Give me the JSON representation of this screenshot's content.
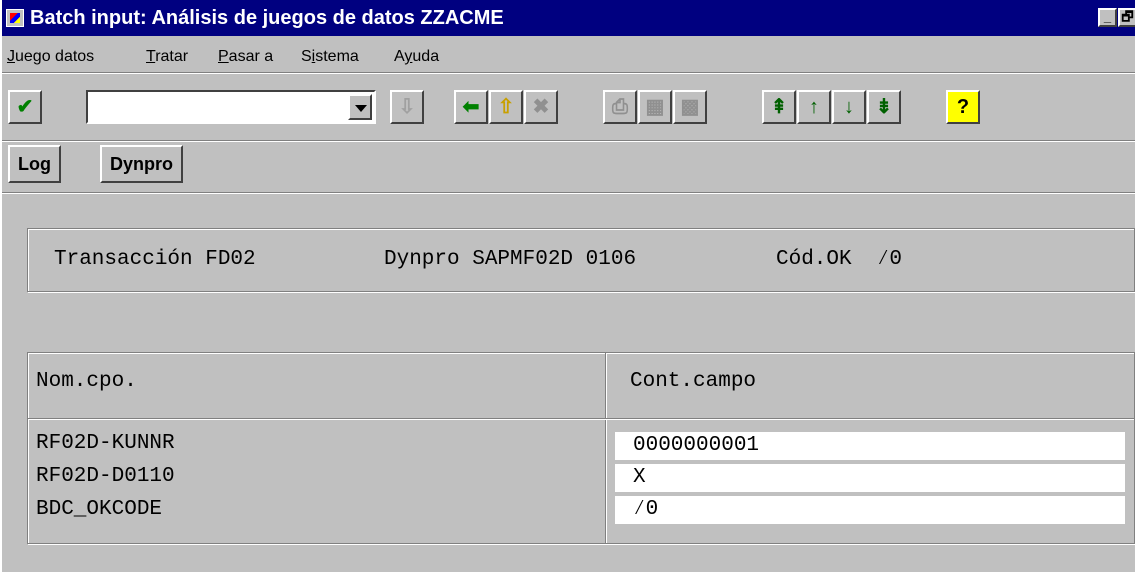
{
  "window": {
    "title": "Batch input: Análisis de juegos de datos ZZACME",
    "buttons": [
      "_",
      "🗗"
    ]
  },
  "menubar": {
    "items": [
      {
        "key": "J",
        "rest": "uego datos"
      },
      {
        "key": "T",
        "rest": "ratar"
      },
      {
        "key": "P",
        "rest": "asar a"
      },
      {
        "pre": "S",
        "key": "i",
        "rest": "stema"
      },
      {
        "pre": "A",
        "key": "y",
        "rest": "uda"
      }
    ]
  },
  "toolbar": {
    "command_value": "",
    "icons": {
      "enter": "check-icon",
      "save": "save-icon",
      "back": "arrow-left-icon",
      "exit": "up-arrow-icon",
      "cancel": "cancel-icon",
      "print": "print-icon",
      "find": "find-icon",
      "find_next": "find-next-icon",
      "first": "first-page-icon",
      "prev": "previous-page-icon",
      "next": "next-page-icon",
      "last": "last-page-icon",
      "help": "help-icon"
    }
  },
  "appbar": {
    "log_label": "Log",
    "dynpro_label": "Dynpro"
  },
  "info": {
    "transaction": "Transacción FD02",
    "dynpro": "Dynpro SAPMF02D 0106",
    "okcode": "Cód.OK  ⁄0"
  },
  "table": {
    "headers": [
      "Nom.cpo.",
      "Cont.campo"
    ],
    "rows": [
      {
        "name": "RF02D-KUNNR",
        "value": "0000000001"
      },
      {
        "name": "RF02D-D0110",
        "value": "X"
      },
      {
        "name": "BDC_OKCODE",
        "value": "⁄0"
      }
    ]
  }
}
